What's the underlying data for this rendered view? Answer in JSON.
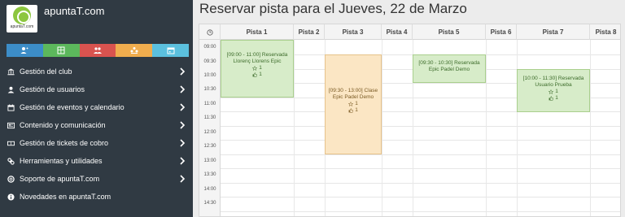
{
  "brand": {
    "name": "apuntaT.com",
    "logo_text": "apuntaT.com"
  },
  "quick_actions": [
    {
      "icon": "add-user-icon",
      "color": "#3c8dc8"
    },
    {
      "icon": "list-icon",
      "color": "#5cb85c"
    },
    {
      "icon": "users-icon",
      "color": "#d9534f"
    },
    {
      "icon": "group-icon",
      "color": "#f0ad4e"
    },
    {
      "icon": "calendar-icon",
      "color": "#5bc0de"
    }
  ],
  "sidebar": {
    "items": [
      {
        "label": "Gestión del club",
        "icon": "bank-icon"
      },
      {
        "label": "Gestión de usuarios",
        "icon": "user-icon"
      },
      {
        "label": "Gestión de eventos y calendario",
        "icon": "calendar-icon"
      },
      {
        "label": "Contenido y comunicación",
        "icon": "newspaper-icon"
      },
      {
        "label": "Gestión de tickets de cobro",
        "icon": "ticket-icon"
      },
      {
        "label": "Herramientas y utilidades",
        "icon": "wrench-icon"
      },
      {
        "label": "Soporte de apuntaT.com",
        "icon": "lifebuoy-icon"
      },
      {
        "label": "Novedades en apuntaT.com",
        "icon": "info-icon"
      }
    ]
  },
  "main": {
    "title": "Reservar pista para el Jueves, 22 de Marzo",
    "courts": [
      "Pista 1",
      "Pista 2",
      "Pista 3",
      "Pista 4",
      "Pista 5",
      "Pista 6",
      "Pista 7",
      "Pista 8"
    ],
    "times": [
      "09:00",
      "09:30",
      "10:00",
      "10:30",
      "11:00",
      "11:30",
      "12:00",
      "12:30",
      "13:00",
      "13:30",
      "14:00",
      "14:30"
    ],
    "events": [
      {
        "court": "Pista 1",
        "line1": "[09:00 - 11:00] Reservada",
        "line2": "Llorenç Llorens Epic",
        "stars": "1",
        "likes": "1"
      },
      {
        "court": "Pista 3",
        "line1": "[09:30 - 13:00] Clase",
        "line2": "Epic Padel Demo",
        "stars": "1",
        "likes": "1"
      },
      {
        "court": "Pista 5",
        "line1": "[09:30 - 10:30] Reservada",
        "line2": "Epic Padel Demo"
      },
      {
        "court": "Pista 7",
        "line1": "[10:00 - 11:30] Reservada",
        "line2": "Usuario Prueba",
        "stars": "1",
        "likes": "1"
      }
    ]
  }
}
